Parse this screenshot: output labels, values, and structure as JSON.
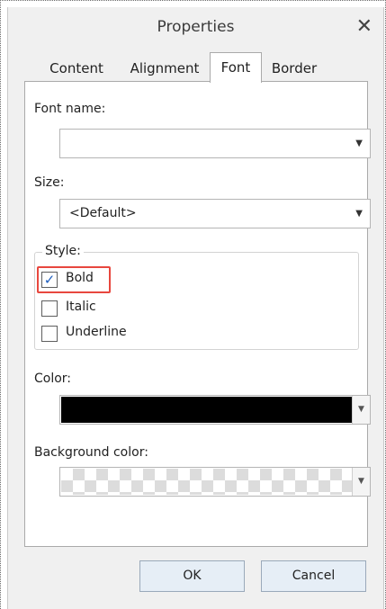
{
  "dialog": {
    "title": "Properties",
    "close_glyph": "✕"
  },
  "tabs": [
    {
      "label": "Content"
    },
    {
      "label": "Alignment"
    },
    {
      "label": "Font"
    },
    {
      "label": "Border"
    }
  ],
  "active_tab": "Font",
  "font": {
    "font_name_label": "Font name:",
    "font_name_value": "",
    "size_label": "Size:",
    "size_value": "<Default>",
    "style_label": "Style:",
    "styles": [
      {
        "label": "Bold",
        "checked": true
      },
      {
        "label": "Italic",
        "checked": false
      },
      {
        "label": "Underline",
        "checked": false
      }
    ],
    "color_label": "Color:",
    "color_value": "#000000",
    "background_color_label": "Background color:",
    "background_color_value": "transparent"
  },
  "icons": {
    "dropdown_arrow": "▼",
    "checkmark": "✓"
  },
  "buttons": {
    "ok_label": "OK",
    "cancel_label": "Cancel"
  },
  "colors": {
    "highlight": "#e8473e",
    "check_accent": "#1f5fbf",
    "button_bg": "#e6eef6"
  }
}
